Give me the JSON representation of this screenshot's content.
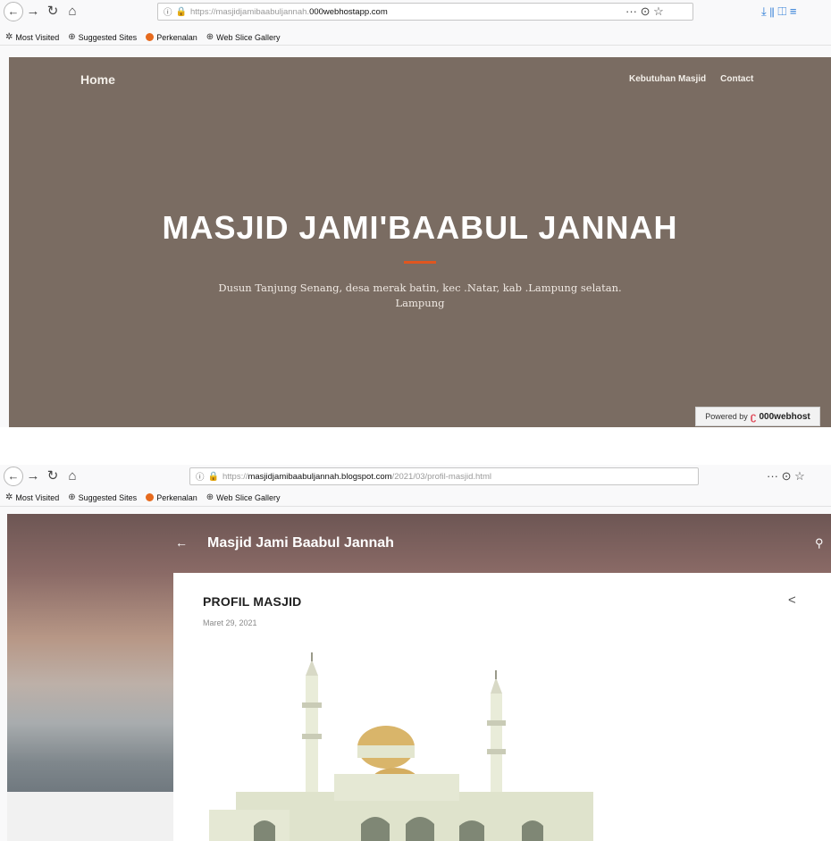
{
  "browser1": {
    "url_prefix": "https://masjidjamibaabuljannah.",
    "url_host": "000webhostapp.com",
    "actions": "··· ⊙ ☆",
    "right_icons": "⤓  ⫴  ◫  ≡",
    "bookmarks": [
      "Most Visited",
      "Suggested Sites",
      "Perkenalan",
      "Web Slice Gallery"
    ]
  },
  "site": {
    "nav_home": "Home",
    "nav_right": [
      "Kebutuhan Masjid",
      "Contact"
    ],
    "title": "MASJID JAMI'BAABUL JANNAH",
    "subtitle": "Dusun Tanjung Senang, desa merak batin, kec .Natar, kab .Lampung selatan. Lampung",
    "powered_by": "Powered by",
    "powered_brand": "000webhost"
  },
  "browser2": {
    "url_prefix": "https://",
    "url_host": "masjidjamibaabuljannah.blogspot.com",
    "url_path": "/2021/03/profil-masjid.html",
    "actions": "··· ⊙ ☆",
    "bookmarks": [
      "Most Visited",
      "Suggested Sites",
      "Perkenalan",
      "Web Slice Gallery"
    ]
  },
  "blog": {
    "header_title": "Masjid Jami Baabul Jannah",
    "post_title": "PROFIL MASJID",
    "post_date": "Maret 29, 2021"
  },
  "icons": {
    "back": "back-arrow-icon",
    "forward": "forward-arrow-icon",
    "reload": "reload-icon",
    "home": "home-icon",
    "search": "search-icon",
    "share": "share-icon"
  },
  "colors": {
    "hero_bg": "#7a6c62",
    "divider": "#e0561f",
    "page_bg": "#f9f9fa"
  }
}
